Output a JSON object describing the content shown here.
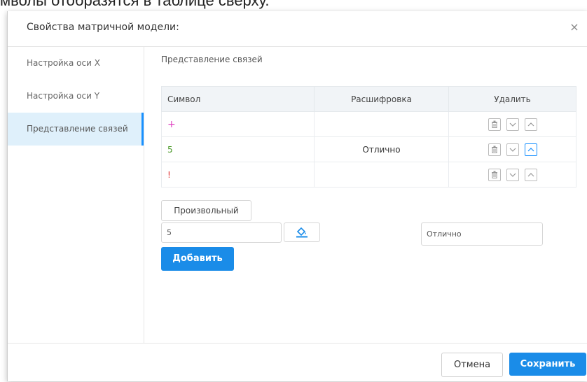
{
  "background_text": "мволы отобразятся в таблице сверху.",
  "modal": {
    "title": "Свойства матричной модели:",
    "close_icon": "×"
  },
  "sidebar": {
    "items": [
      {
        "label": "Настройка оси X",
        "active": false
      },
      {
        "label": "Настройка оси Y",
        "active": false
      },
      {
        "label": "Представление связей",
        "active": true
      }
    ]
  },
  "content": {
    "section_title": "Представление связей",
    "table": {
      "headers": [
        "Символ",
        "Расшифровка",
        "Удалить"
      ],
      "rows": [
        {
          "symbol": "+",
          "decode": ""
        },
        {
          "symbol": "5",
          "decode": "Отлично"
        },
        {
          "symbol": "!",
          "decode": ""
        }
      ]
    },
    "custom_button": "Произвольный",
    "symbol_input_value": "5",
    "decode_input_value": "Отлично",
    "add_button": "Добавить"
  },
  "footer": {
    "cancel": "Отмена",
    "save": "Сохранить"
  },
  "colors": {
    "accent": "#1a8ce8",
    "plus_symbol": "#e040c0",
    "five_symbol": "#4c9a2a",
    "excl_symbol": "#e03030"
  }
}
